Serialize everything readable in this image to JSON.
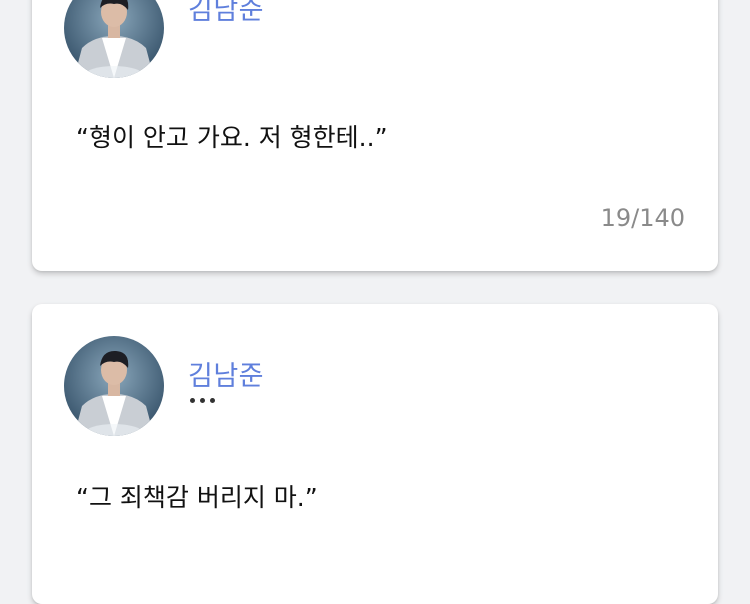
{
  "posts": [
    {
      "author": "김남준",
      "quote": "“형이 안고 가요. 저 형한테..”",
      "counter": "19/140"
    },
    {
      "author": "김남준",
      "quote": "“그 죄책감 버리지 마.”",
      "status": "typing"
    }
  ],
  "colors": {
    "background": "#f1f2f4",
    "card": "#ffffff",
    "author_name": "#5f7fdc",
    "counter": "#8a8a8a"
  }
}
